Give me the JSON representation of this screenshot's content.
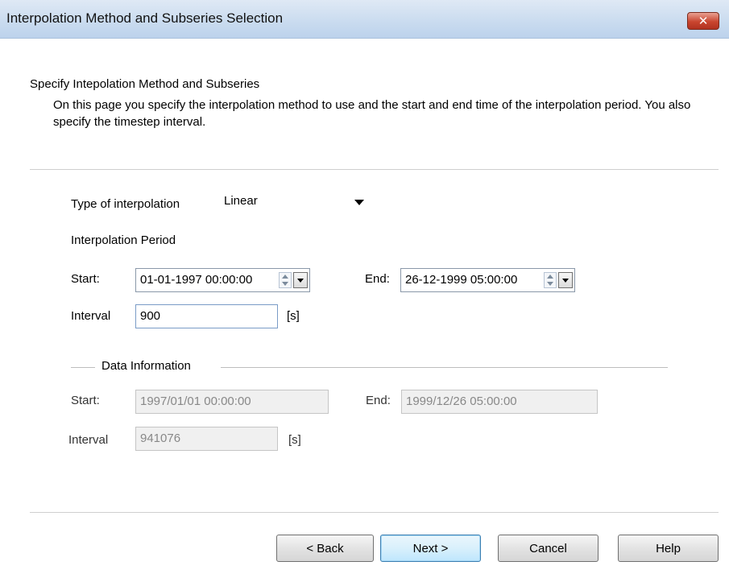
{
  "window": {
    "title": "Interpolation Method and Subseries Selection"
  },
  "header": {
    "heading": "Specify Intepolation Method and Subseries",
    "description": "On this page you specify the interpolation method to use and the start and end time of the interpolation period. You also specify the timestep interval."
  },
  "interpolation": {
    "type_label": "Type of interpolation",
    "type_value": "Linear",
    "period_label": "Interpolation Period",
    "start_label": "Start:",
    "start_value": "01-01-1997 00:00:00",
    "end_label": "End:",
    "end_value": "26-12-1999 05:00:00",
    "interval_label": "Interval",
    "interval_value": "900",
    "interval_unit": "[s]"
  },
  "data_info": {
    "group_label": "Data Information",
    "start_label": "Start:",
    "start_value": "1997/01/01 00:00:00",
    "end_label": "End:",
    "end_value": "1999/12/26 05:00:00",
    "interval_label": "Interval",
    "interval_value": "941076",
    "interval_unit": "[s]"
  },
  "buttons": {
    "back": "< Back",
    "next": "Next >",
    "cancel": "Cancel",
    "help": "Help"
  }
}
